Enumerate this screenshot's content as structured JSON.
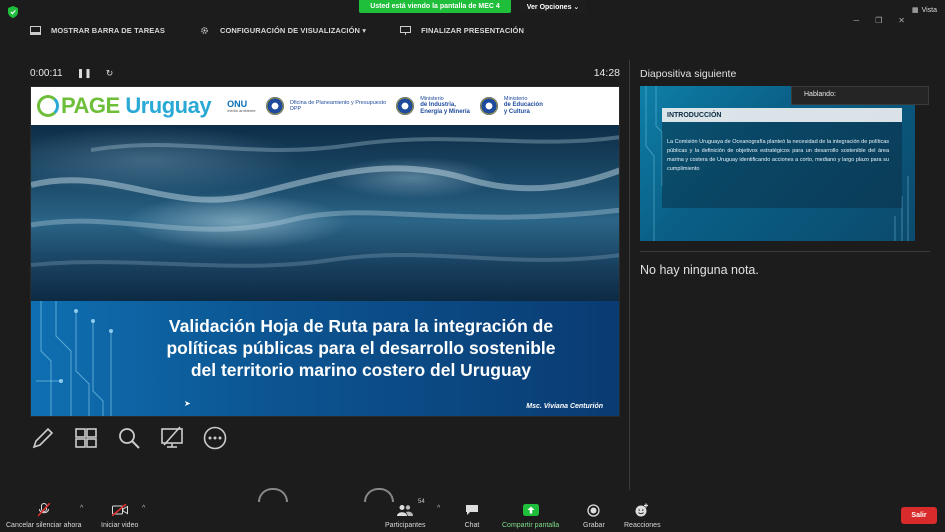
{
  "banner": {
    "text": "Usted está viendo la pantalla de MEC 4",
    "view_options": "Ver Opciones ⌄"
  },
  "window": {
    "vista": "Vista"
  },
  "toolbar": {
    "show_taskbar": "MOSTRAR BARRA DE TAREAS",
    "display_settings": "CONFIGURACIÓN DE VISUALIZACIÓN ▾",
    "end_presentation": "FINALIZAR PRESENTACIÓN"
  },
  "presenter": {
    "elapsed": "0:00:11",
    "clock": "14:28"
  },
  "slide": {
    "logo_page": "PAGE",
    "logo_uruguay": "Uruguay",
    "onu": "ONU",
    "onu_sub": "medio ambiente",
    "inst1": "Oficina de Planeamiento y Presupuesto",
    "inst1_sub": "OPP",
    "inst2_a": "Ministerio",
    "inst2_b": "de Industria,",
    "inst2_c": "Energía y Minería",
    "inst3_a": "Ministerio",
    "inst3_b": "de Educación",
    "inst3_c": "y Cultura",
    "title_line1": "Validación Hoja de Ruta para la integración de",
    "title_line2": "políticas públicas para el desarrollo sostenible",
    "title_line3": "del territorio marino costero del Uruguay",
    "author": "Msc. Viviana Centurión"
  },
  "right_panel": {
    "next_label": "Diapositiva siguiente",
    "next_title": "INTRODUCCIÓN",
    "next_body": "La Comisión Uruguaya de Oceanografía planteó la necesidad de la integración de políticas públicas y la definición de objetivos estratégicos para un desarrollo sostenible del área marina y costera de Uruguay identificando acciones a corto, mediano y largo plazo para su cumplimiento",
    "speaking": "Hablando:",
    "notes": "No hay ninguna nota."
  },
  "bottom": {
    "mute": "Cancelar silenciar ahora",
    "video": "Iniciar video",
    "participants": "Participantes",
    "participants_count": "54",
    "chat": "Chat",
    "share": "Compartir pantalla",
    "record": "Grabar",
    "reactions": "Reacciones",
    "exit": "Salir"
  },
  "colors": {
    "share_green": "#1fbf3c",
    "exit_red": "#d92b2b",
    "background": "#1c1c1c"
  }
}
